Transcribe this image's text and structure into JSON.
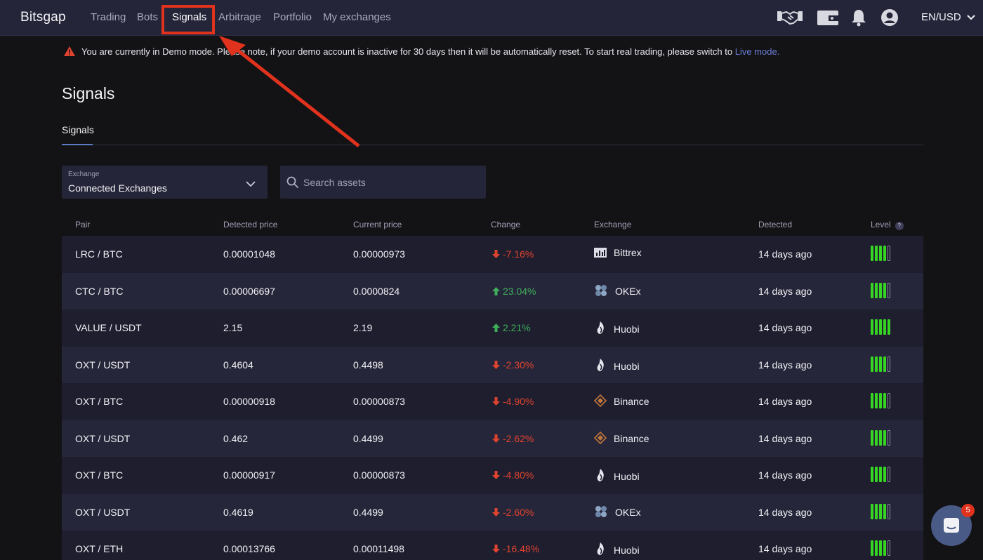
{
  "nav": {
    "brand": "Bitsgap",
    "items": [
      "Trading",
      "Bots",
      "Signals",
      "Arbitrage",
      "Portfolio",
      "My exchanges"
    ],
    "active": "Signals",
    "locale": "EN/USD",
    "icons": [
      "handshake-icon",
      "wallet-icon",
      "bell-icon",
      "user-icon"
    ]
  },
  "notice": {
    "text": "You are currently in Demo mode. Please note, if your demo account is inactive for 30 days then it will be automatically reset. To start real trading, please switch to ",
    "link": "Live mode."
  },
  "page": {
    "title": "Signals",
    "tab": "Signals"
  },
  "filters": {
    "exchange_label": "Exchange",
    "exchange_value": "Connected Exchanges",
    "search_placeholder": "Search assets"
  },
  "table": {
    "headers": {
      "pair": "Pair",
      "detected_price": "Detected price",
      "current_price": "Current price",
      "change": "Change",
      "exchange": "Exchange",
      "detected": "Detected",
      "level": "Level"
    },
    "rows": [
      {
        "pair": "LRC / BTC",
        "detected_price": "0.00001048",
        "current_price": "0.00000973",
        "change": "-7.16%",
        "direction": "down",
        "exchange": "Bittrex",
        "detected": "14 days ago",
        "level": 4
      },
      {
        "pair": "CTC / BTC",
        "detected_price": "0.00006697",
        "current_price": "0.0000824",
        "change": "23.04%",
        "direction": "up",
        "exchange": "OKEx",
        "detected": "14 days ago",
        "level": 4
      },
      {
        "pair": "VALUE / USDT",
        "detected_price": "2.15",
        "current_price": "2.19",
        "change": "2.21%",
        "direction": "up",
        "exchange": "Huobi",
        "detected": "14 days ago",
        "level": 5
      },
      {
        "pair": "OXT / USDT",
        "detected_price": "0.4604",
        "current_price": "0.4498",
        "change": "-2.30%",
        "direction": "down",
        "exchange": "Huobi",
        "detected": "14 days ago",
        "level": 4
      },
      {
        "pair": "OXT / BTC",
        "detected_price": "0.00000918",
        "current_price": "0.00000873",
        "change": "-4.90%",
        "direction": "down",
        "exchange": "Binance",
        "detected": "14 days ago",
        "level": 4
      },
      {
        "pair": "OXT / USDT",
        "detected_price": "0.462",
        "current_price": "0.4499",
        "change": "-2.62%",
        "direction": "down",
        "exchange": "Binance",
        "detected": "14 days ago",
        "level": 4
      },
      {
        "pair": "OXT / BTC",
        "detected_price": "0.00000917",
        "current_price": "0.00000873",
        "change": "-4.80%",
        "direction": "down",
        "exchange": "Huobi",
        "detected": "14 days ago",
        "level": 4
      },
      {
        "pair": "OXT / USDT",
        "detected_price": "0.4619",
        "current_price": "0.4499",
        "change": "-2.60%",
        "direction": "down",
        "exchange": "OKEx",
        "detected": "14 days ago",
        "level": 4
      },
      {
        "pair": "OXT / ETH",
        "detected_price": "0.00013766",
        "current_price": "0.00011498",
        "change": "-16.48%",
        "direction": "down",
        "exchange": "Huobi",
        "detected": "14 days ago",
        "level": 4
      }
    ]
  },
  "chat": {
    "badge": "5"
  },
  "colors": {
    "accent": "#5d79c8",
    "up": "#3fae5a",
    "down": "#e0432e",
    "level_on": "#36d423",
    "highlight": "#e0321c"
  }
}
